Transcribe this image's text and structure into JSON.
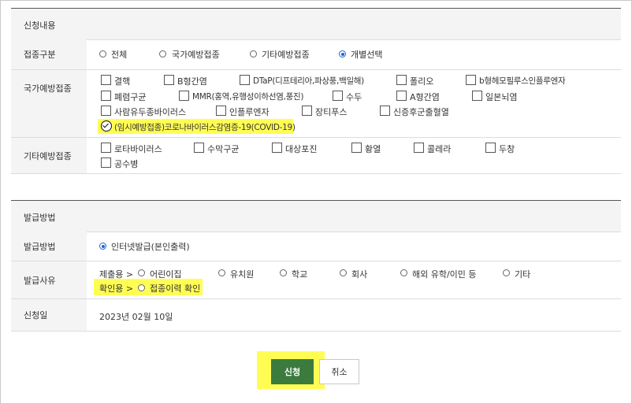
{
  "section1": {
    "title": "신청내용"
  },
  "vaccine_type": {
    "label": "접종구분",
    "options": [
      "전체",
      "국가예방접종",
      "기타예방접종",
      "개별선택"
    ],
    "selected": "개별선택"
  },
  "national": {
    "label": "국가예방접종",
    "items": [
      "결핵",
      "B형간염",
      "DTaP(디프테리아,파상풍,백일해)",
      "폴리오",
      "b형헤모필루스인플루엔자",
      "폐렴구균",
      "MMR(홍역,유행성이하선염,풍진)",
      "수두",
      "A형간염",
      "일본뇌염",
      "사람유두종바이러스",
      "인플루엔자",
      "장티푸스",
      "신증후군출혈열",
      "(임시예방접종)코로나바이러스감염증-19(COVID-19)"
    ],
    "checked": "(임시예방접종)코로나바이러스감염증-19(COVID-19)"
  },
  "other": {
    "label": "기타예방접종",
    "items": [
      "로타바이러스",
      "수막구균",
      "대상포진",
      "황열",
      "콜레라",
      "두창",
      "공수병"
    ]
  },
  "section2": {
    "title": "발급방법"
  },
  "method": {
    "label": "발급방법",
    "option": "인터넷발급(본인출력)"
  },
  "reason": {
    "label": "발급사유",
    "submit_prefix": "제출용 >",
    "submit_options": [
      "어린이집",
      "유치원",
      "학교",
      "회사",
      "해외 유학/이민 등",
      "기타"
    ],
    "confirm_prefix": "확인용 >",
    "confirm_option": "접종이력 확인"
  },
  "date": {
    "label": "신청일",
    "value": "2023년 02월 10일"
  },
  "buttons": {
    "apply": "신청",
    "cancel": "취소"
  },
  "colors": {
    "highlight": "#fffd54",
    "apply_bg": "#3c7b3e",
    "radio_selected": "#1c66d6"
  }
}
